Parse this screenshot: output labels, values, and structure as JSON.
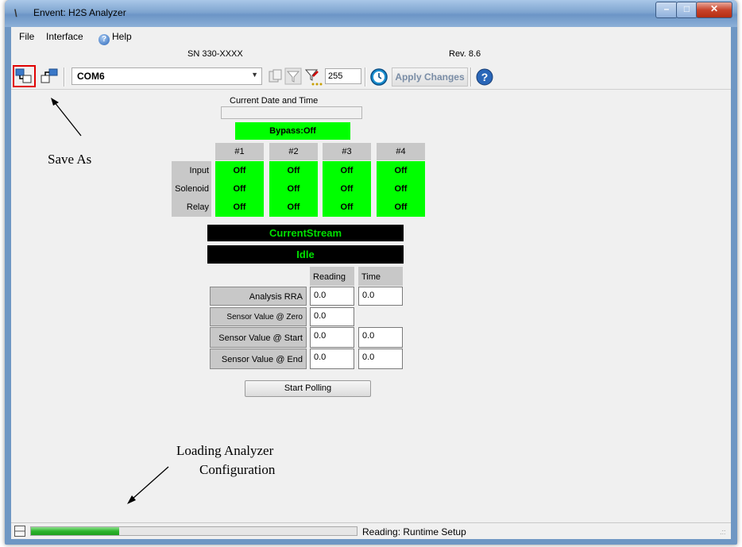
{
  "window": {
    "title": "Envent: H2S Analyzer",
    "icon": "app-icon"
  },
  "menu": {
    "file": "File",
    "interface": "Interface",
    "help": "Help"
  },
  "info": {
    "serial": "SN 330-XXXX",
    "revision": "Rev. 8.6"
  },
  "toolbar": {
    "port": "COM6",
    "count_value": "255",
    "apply_label": "Apply Changes",
    "icons": [
      "save-as-icon",
      "load-config-icon",
      "copy-icon",
      "filter-icon",
      "filter-dots-icon",
      "clock-icon",
      "help-icon"
    ]
  },
  "datetime": {
    "label": "Current Date and Time",
    "value": ""
  },
  "bypass": {
    "label": "Bypass:Off"
  },
  "streams": {
    "headers": [
      "#1",
      "#2",
      "#3",
      "#4"
    ],
    "rows": [
      {
        "label": "Input",
        "values": [
          "Off",
          "Off",
          "Off",
          "Off"
        ]
      },
      {
        "label": "Solenoid",
        "values": [
          "Off",
          "Off",
          "Off",
          "Off"
        ]
      },
      {
        "label": "Relay",
        "values": [
          "Off",
          "Off",
          "Off",
          "Off"
        ]
      }
    ]
  },
  "current_stream": {
    "label": "CurrentStream",
    "status": "Idle"
  },
  "readings": {
    "col_reading": "Reading",
    "col_time": "Time",
    "rows": [
      {
        "label": "Analysis RRA",
        "reading": "0.0",
        "time": "0.0"
      },
      {
        "label": "Sensor Value @ Zero",
        "reading": "0.0",
        "time": null
      },
      {
        "label": "Sensor Value @ Start",
        "reading": "0.0",
        "time": "0.0"
      },
      {
        "label": "Sensor Value @ End",
        "reading": "0.0",
        "time": "0.0"
      }
    ]
  },
  "start_polling": "Start Polling",
  "annotations": {
    "save_as": "Save As",
    "loading_line1": "Loading Analyzer",
    "loading_line2": "Configuration"
  },
  "status": {
    "text": "Reading: Runtime Setup",
    "progress": 0.27
  },
  "colors": {
    "status_on": "#00ff00",
    "highlight_box": "#e00000",
    "stream_text": "#00e000"
  }
}
